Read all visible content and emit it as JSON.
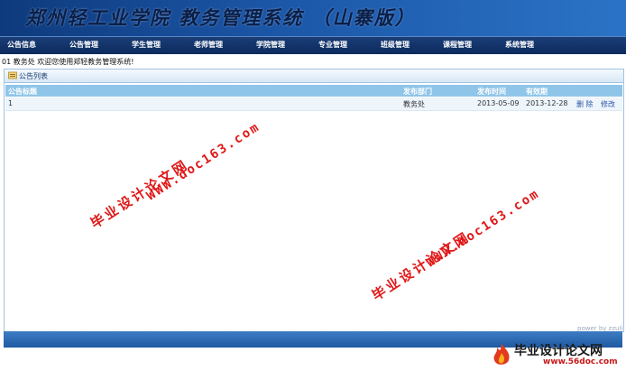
{
  "app": {
    "title": "郑州轻工业学院 教务管理系统 （山寨版）"
  },
  "nav": [
    {
      "label": "公告信息"
    },
    {
      "label": "公告管理"
    },
    {
      "label": "学生管理"
    },
    {
      "label": "老师管理"
    },
    {
      "label": "学院管理"
    },
    {
      "label": "专业管理"
    },
    {
      "label": "班级管理"
    },
    {
      "label": "课程管理"
    },
    {
      "label": "系统管理"
    }
  ],
  "welcome": "01 教务处 欢迎您使用郑轻教务管理系统!",
  "panel": {
    "title": "公告列表",
    "columns": [
      "公告标题",
      "发布部门",
      "发布时间",
      "有效期"
    ],
    "rows": [
      {
        "title": "1",
        "dept": "教务处",
        "publish": "2013-05-09",
        "expire": "2013-12-28",
        "delete": "删 除",
        "edit": "修改"
      }
    ]
  },
  "footer": {
    "power": "power by zzuli"
  },
  "watermark": {
    "url": "WWW.doc163.com",
    "name": "毕业设计论文网",
    "logo_text": "毕业设计论文网",
    "logo_url": "www.56doc.com",
    "color": "#e01818"
  },
  "colors": {
    "header": "#1c57a8",
    "nav": "#0d2a5c",
    "table_header": "#8fc5e9",
    "row": "#eef5fb",
    "link": "#2a56a6"
  }
}
